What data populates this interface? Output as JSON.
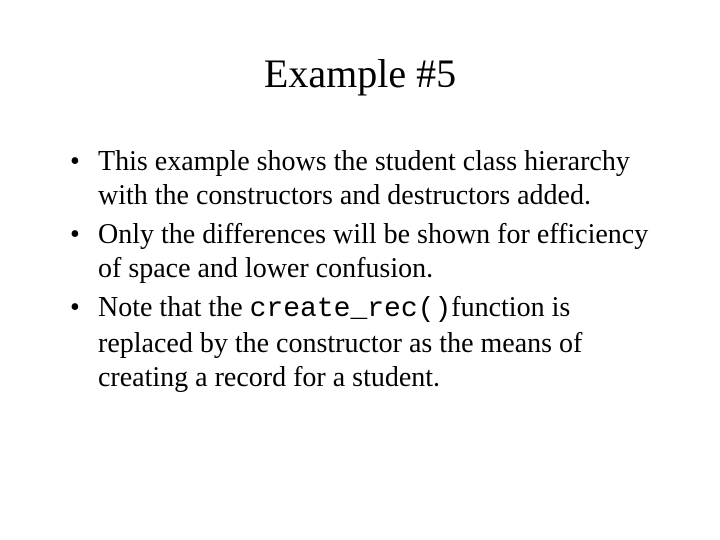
{
  "title": "Example #5",
  "bullets": {
    "b0": "This example shows the student class hierarchy with the constructors and destructors added.",
    "b1": "Only the differences will be shown for efficiency of space and lower confusion.",
    "b2_pre": "Note that the ",
    "b2_code": "create_rec()",
    "b2_post": "function is replaced by the constructor as the means of creating a record for a student."
  }
}
